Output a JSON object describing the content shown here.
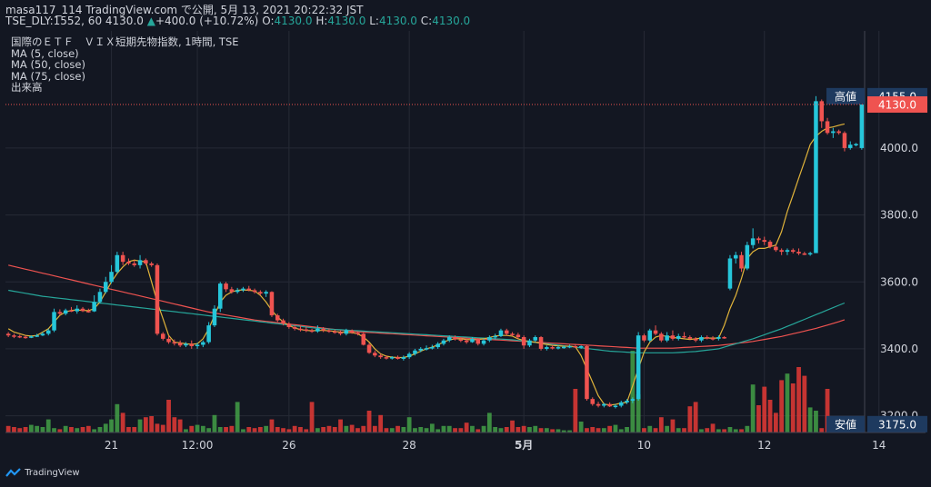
{
  "header": {
    "line1": "masa117_114 TradingView.com で公開, 5月 13, 2021 20:22:32 JST",
    "symbol": "TSE_DLY:1552, 60",
    "price": "4130.0",
    "change_arrow": "▲",
    "change": "+400.0 (+10.72%)",
    "o_label": "O:",
    "o_value": "4130.0",
    "h_label": "H:",
    "h_value": "4130.0",
    "l_label": "L:",
    "l_value": "4130.0",
    "c_label": "C:",
    "c_value": "4130.0"
  },
  "legend": {
    "title": "国際のＥＴＦ　ＶＩＸ短期先物指数, 1時間, TSE",
    "ma5": "MA (5, close)",
    "ma50": "MA (50, close)",
    "ma75": "MA (75, close)",
    "volume": "出来高"
  },
  "watermark": "TradingView",
  "colors": {
    "background": "#131722",
    "up": "#26c6da",
    "down": "#ef5350",
    "vol_up": "#43a047",
    "vol_down": "#e53935",
    "ma5": "#e0b33a",
    "ma50": "#26a69a",
    "ma75": "#ef5350",
    "label_box": "#1e3a5f"
  },
  "chart_data": {
    "type": "candlestick",
    "title": "国際のＥＴＦ　ＶＩＸ短期先物指数, 1時間, TSE",
    "ylim": [
      3150,
      4350
    ],
    "y_ticks": [
      "3200.0",
      "3400.0",
      "3600.0",
      "3800.0",
      "4000.0"
    ],
    "y_tick_values": [
      3200,
      3400,
      3600,
      3800,
      4000
    ],
    "x_labels": [
      "21",
      "12:00",
      "26",
      "28",
      "5月",
      "10",
      "12",
      "14"
    ],
    "x_label_bars": [
      18,
      33,
      49,
      70,
      90,
      111,
      132,
      152
    ],
    "markers": [
      {
        "label": "高値",
        "value": 4155.0,
        "text": "4155.0"
      },
      {
        "label": "",
        "value": 4130.0,
        "text": "4130.0"
      },
      {
        "label": "安値",
        "value": 3175.0,
        "text": "3175.0"
      }
    ],
    "candles": [
      [
        3445,
        3450,
        3435,
        3440
      ],
      [
        3440,
        3445,
        3432,
        3438
      ],
      [
        3438,
        3442,
        3432,
        3436
      ],
      [
        3436,
        3440,
        3430,
        3434
      ],
      [
        3434,
        3440,
        3432,
        3437
      ],
      [
        3437,
        3445,
        3435,
        3440
      ],
      [
        3440,
        3450,
        3438,
        3445
      ],
      [
        3445,
        3460,
        3440,
        3455
      ],
      [
        3455,
        3520,
        3450,
        3510
      ],
      [
        3510,
        3518,
        3500,
        3505
      ],
      [
        3505,
        3520,
        3500,
        3515
      ],
      [
        3515,
        3525,
        3510,
        3512
      ],
      [
        3512,
        3530,
        3505,
        3520
      ],
      [
        3520,
        3525,
        3510,
        3513
      ],
      [
        3513,
        3520,
        3508,
        3512
      ],
      [
        3512,
        3560,
        3510,
        3540
      ],
      [
        3540,
        3580,
        3535,
        3570
      ],
      [
        3570,
        3615,
        3565,
        3600
      ],
      [
        3600,
        3650,
        3595,
        3630
      ],
      [
        3630,
        3690,
        3625,
        3680
      ],
      [
        3680,
        3690,
        3650,
        3660
      ],
      [
        3660,
        3670,
        3650,
        3655
      ],
      [
        3655,
        3665,
        3645,
        3650
      ],
      [
        3650,
        3680,
        3640,
        3665
      ],
      [
        3665,
        3670,
        3650,
        3655
      ],
      [
        3655,
        3660,
        3645,
        3650
      ],
      [
        3650,
        3655,
        3440,
        3445
      ],
      [
        3445,
        3450,
        3425,
        3430
      ],
      [
        3430,
        3440,
        3415,
        3420
      ],
      [
        3420,
        3428,
        3410,
        3418
      ],
      [
        3418,
        3425,
        3405,
        3410
      ],
      [
        3410,
        3420,
        3405,
        3415
      ],
      [
        3415,
        3425,
        3400,
        3408
      ],
      [
        3408,
        3418,
        3400,
        3412
      ],
      [
        3412,
        3425,
        3405,
        3420
      ],
      [
        3420,
        3480,
        3415,
        3470
      ],
      [
        3470,
        3530,
        3465,
        3520
      ],
      [
        3520,
        3600,
        3510,
        3595
      ],
      [
        3595,
        3600,
        3570,
        3578
      ],
      [
        3578,
        3585,
        3565,
        3570
      ],
      [
        3570,
        3582,
        3565,
        3575
      ],
      [
        3575,
        3585,
        3570,
        3580
      ],
      [
        3580,
        3588,
        3572,
        3575
      ],
      [
        3575,
        3580,
        3565,
        3570
      ],
      [
        3570,
        3575,
        3560,
        3565
      ],
      [
        3565,
        3575,
        3555,
        3570
      ],
      [
        3570,
        3572,
        3495,
        3500
      ],
      [
        3500,
        3505,
        3480,
        3485
      ],
      [
        3485,
        3490,
        3470,
        3475
      ],
      [
        3475,
        3480,
        3460,
        3465
      ],
      [
        3465,
        3470,
        3455,
        3460
      ],
      [
        3460,
        3468,
        3452,
        3458
      ],
      [
        3458,
        3465,
        3450,
        3455
      ],
      [
        3455,
        3460,
        3448,
        3452
      ],
      [
        3452,
        3470,
        3448,
        3460
      ],
      [
        3460,
        3465,
        3450,
        3455
      ],
      [
        3455,
        3460,
        3448,
        3452
      ],
      [
        3452,
        3458,
        3445,
        3450
      ],
      [
        3450,
        3455,
        3440,
        3445
      ],
      [
        3445,
        3460,
        3440,
        3455
      ],
      [
        3455,
        3458,
        3445,
        3448
      ],
      [
        3448,
        3452,
        3440,
        3445
      ],
      [
        3445,
        3448,
        3410,
        3412
      ],
      [
        3412,
        3418,
        3385,
        3388
      ],
      [
        3388,
        3395,
        3375,
        3380
      ],
      [
        3380,
        3385,
        3370,
        3375
      ],
      [
        3375,
        3380,
        3368,
        3372
      ],
      [
        3372,
        3378,
        3368,
        3375
      ],
      [
        3375,
        3380,
        3368,
        3370
      ],
      [
        3370,
        3380,
        3365,
        3375
      ],
      [
        3375,
        3390,
        3370,
        3385
      ],
      [
        3385,
        3400,
        3380,
        3395
      ],
      [
        3395,
        3405,
        3390,
        3400
      ],
      [
        3400,
        3410,
        3395,
        3402
      ],
      [
        3402,
        3412,
        3398,
        3405
      ],
      [
        3405,
        3420,
        3400,
        3415
      ],
      [
        3415,
        3430,
        3410,
        3425
      ],
      [
        3425,
        3440,
        3420,
        3435
      ],
      [
        3435,
        3440,
        3425,
        3428
      ],
      [
        3428,
        3435,
        3420,
        3425
      ],
      [
        3425,
        3430,
        3415,
        3420
      ],
      [
        3420,
        3435,
        3418,
        3430
      ],
      [
        3430,
        3432,
        3410,
        3415
      ],
      [
        3415,
        3430,
        3410,
        3425
      ],
      [
        3425,
        3440,
        3420,
        3435
      ],
      [
        3435,
        3445,
        3428,
        3438
      ],
      [
        3438,
        3460,
        3435,
        3455
      ],
      [
        3455,
        3460,
        3440,
        3445
      ],
      [
        3445,
        3450,
        3438,
        3442
      ],
      [
        3442,
        3448,
        3430,
        3435
      ],
      [
        3435,
        3440,
        3400,
        3410
      ],
      [
        3410,
        3430,
        3405,
        3425
      ],
      [
        3425,
        3440,
        3420,
        3435
      ],
      [
        3435,
        3438,
        3395,
        3400
      ],
      [
        3400,
        3410,
        3395,
        3405
      ],
      [
        3405,
        3412,
        3398,
        3402
      ],
      [
        3402,
        3410,
        3398,
        3405
      ],
      [
        3405,
        3410,
        3400,
        3406
      ],
      [
        3406,
        3412,
        3402,
        3408
      ],
      [
        3408,
        3412,
        3403,
        3405
      ],
      [
        3405,
        3410,
        3400,
        3408
      ],
      [
        3408,
        3410,
        3245,
        3250
      ],
      [
        3250,
        3255,
        3230,
        3235
      ],
      [
        3235,
        3242,
        3225,
        3230
      ],
      [
        3230,
        3238,
        3225,
        3235
      ],
      [
        3235,
        3240,
        3226,
        3228
      ],
      [
        3228,
        3235,
        3222,
        3230
      ],
      [
        3230,
        3245,
        3225,
        3240
      ],
      [
        3240,
        3250,
        3235,
        3245
      ],
      [
        3245,
        3255,
        3238,
        3250
      ],
      [
        3250,
        3450,
        3245,
        3440
      ],
      [
        3440,
        3445,
        3420,
        3425
      ],
      [
        3425,
        3460,
        3420,
        3455
      ],
      [
        3455,
        3470,
        3440,
        3445
      ],
      [
        3445,
        3450,
        3420,
        3425
      ],
      [
        3425,
        3450,
        3420,
        3440
      ],
      [
        3440,
        3455,
        3425,
        3430
      ],
      [
        3430,
        3445,
        3425,
        3438
      ],
      [
        3438,
        3450,
        3430,
        3435
      ],
      [
        3435,
        3440,
        3428,
        3430
      ],
      [
        3430,
        3435,
        3420,
        3425
      ],
      [
        3425,
        3440,
        3420,
        3435
      ],
      [
        3435,
        3440,
        3428,
        3432
      ],
      [
        3432,
        3438,
        3425,
        3430
      ],
      [
        3430,
        3440,
        3425,
        3435
      ],
      [
        3435,
        3438,
        3430,
        3432
      ],
      [
        3580,
        3680,
        3575,
        3670
      ],
      [
        3670,
        3690,
        3655,
        3680
      ],
      [
        3680,
        3690,
        3630,
        3640
      ],
      [
        3640,
        3720,
        3635,
        3710
      ],
      [
        3710,
        3760,
        3700,
        3730
      ],
      [
        3730,
        3735,
        3715,
        3725
      ],
      [
        3725,
        3735,
        3710,
        3720
      ],
      [
        3720,
        3725,
        3700,
        3705
      ],
      [
        3705,
        3710,
        3690,
        3695
      ],
      [
        3695,
        3700,
        3680,
        3690
      ],
      [
        3690,
        3700,
        3680,
        3695
      ],
      [
        3695,
        3700,
        3685,
        3690
      ],
      [
        3690,
        3700,
        3680,
        3685
      ],
      [
        3685,
        3690,
        3680,
        3684
      ],
      [
        3684,
        3690,
        3678,
        3686
      ],
      [
        3686,
        4155,
        4050,
        4140
      ],
      [
        4140,
        4145,
        4060,
        4080
      ],
      [
        4080,
        4090,
        4040,
        4045
      ],
      [
        4045,
        4060,
        4030,
        4050
      ],
      [
        4050,
        4055,
        4040,
        4045
      ],
      [
        4045,
        4050,
        3990,
        4000
      ],
      [
        4000,
        4020,
        3995,
        4010
      ],
      [
        4010,
        4015,
        4005,
        4012
      ],
      [
        4000,
        4130,
        3995,
        4130
      ]
    ],
    "volumes": [
      6,
      5,
      4,
      5,
      7,
      6,
      5,
      12,
      4,
      3,
      6,
      5,
      4,
      5,
      6,
      3,
      5,
      8,
      12,
      26,
      18,
      5,
      5,
      12,
      14,
      15,
      8,
      7,
      30,
      14,
      12,
      3,
      6,
      7,
      6,
      4,
      16,
      5,
      5,
      6,
      28,
      3,
      5,
      4,
      5,
      6,
      12,
      5,
      4,
      3,
      6,
      5,
      3,
      28,
      4,
      5,
      6,
      5,
      12,
      6,
      7,
      4,
      6,
      20,
      6,
      16,
      4,
      4,
      6,
      5,
      14,
      4,
      5,
      4,
      8,
      3,
      6,
      6,
      4,
      4,
      9,
      6,
      3,
      6,
      18,
      5,
      4,
      5,
      11,
      5,
      6,
      5,
      6,
      4,
      4,
      3,
      3,
      2,
      2,
      40,
      10,
      4,
      5,
      4,
      4,
      6,
      7,
      3,
      5,
      75,
      35,
      4,
      6,
      4,
      14,
      6,
      12,
      4,
      4,
      24,
      28,
      3,
      4,
      8,
      3,
      3,
      5,
      3,
      3,
      6,
      44,
      25,
      42,
      30,
      18,
      48,
      54,
      45,
      60,
      52,
      23,
      20,
      4,
      40
    ],
    "ma5": [
      3460,
      3450,
      3445,
      3440,
      3438,
      3440,
      3450,
      3460,
      3480,
      3500,
      3510,
      3515,
      3516,
      3515,
      3514,
      3520,
      3540,
      3570,
      3600,
      3625,
      3645,
      3660,
      3665,
      3662,
      3660,
      3600,
      3540,
      3490,
      3440,
      3420,
      3418,
      3415,
      3414,
      3415,
      3430,
      3460,
      3500,
      3540,
      3560,
      3570,
      3575,
      3576,
      3575,
      3573,
      3560,
      3540,
      3515,
      3495,
      3480,
      3470,
      3462,
      3458,
      3455,
      3454,
      3455,
      3455,
      3454,
      3452,
      3450,
      3449,
      3448,
      3445,
      3435,
      3420,
      3400,
      3385,
      3378,
      3375,
      3374,
      3374,
      3378,
      3385,
      3393,
      3400,
      3405,
      3412,
      3420,
      3427,
      3430,
      3430,
      3428,
      3427,
      3428,
      3430,
      3434,
      3438,
      3440,
      3440,
      3438,
      3430,
      3425,
      3422,
      3420,
      3416,
      3413,
      3410,
      3409,
      3408,
      3408,
      3406,
      3380,
      3340,
      3300,
      3260,
      3235,
      3232,
      3234,
      3238,
      3240,
      3290,
      3340,
      3390,
      3420,
      3435,
      3440,
      3437,
      3434,
      3432,
      3430,
      3428,
      3430,
      3432,
      3432,
      3432,
      3432,
      3470,
      3520,
      3560,
      3610,
      3670,
      3690,
      3700,
      3700,
      3705,
      3710,
      3750,
      3810,
      3860,
      3910,
      3960,
      4010,
      4035,
      4050,
      4060,
      4063,
      4068,
      4072
    ],
    "ma50": [
      3575,
      3572,
      3569,
      3566,
      3563,
      3560,
      3557,
      3555,
      3553,
      3551,
      3549,
      3547,
      3545,
      3543,
      3541,
      3539,
      3537,
      3535,
      3533,
      3531,
      3529,
      3527,
      3525,
      3523,
      3521,
      3519,
      3517,
      3515,
      3513,
      3511,
      3509,
      3507,
      3505,
      3503,
      3501,
      3499,
      3497,
      3495,
      3493,
      3491,
      3489,
      3487,
      3485,
      3483,
      3481,
      3479,
      3477,
      3475,
      3473,
      3471,
      3469,
      3467,
      3465,
      3463,
      3461,
      3460,
      3459,
      3458,
      3457,
      3456,
      3455,
      3454,
      3453,
      3452,
      3451,
      3450,
      3449,
      3448,
      3447,
      3446,
      3445,
      3444,
      3443,
      3442,
      3441,
      3440,
      3439,
      3438,
      3437,
      3436,
      3435,
      3434,
      3433,
      3432,
      3431,
      3430,
      3429,
      3428,
      3427,
      3425,
      3423,
      3421,
      3419,
      3417,
      3415,
      3413,
      3411,
      3409,
      3407,
      3405,
      3403,
      3401,
      3399,
      3397,
      3395,
      3393,
      3392,
      3391,
      3390,
      3389,
      3388,
      3388,
      3388,
      3388,
      3388,
      3388,
      3388,
      3389,
      3390,
      3391,
      3392,
      3394,
      3396,
      3398,
      3400,
      3405,
      3410,
      3415,
      3420,
      3425,
      3430,
      3436,
      3442,
      3448,
      3454,
      3460,
      3467,
      3474,
      3481,
      3488,
      3495,
      3502,
      3509,
      3516,
      3523,
      3530,
      3537
    ],
    "ma75": [
      3650,
      3646,
      3642,
      3638,
      3634,
      3630,
      3626,
      3622,
      3618,
      3614,
      3610,
      3606,
      3602,
      3598,
      3594,
      3590,
      3586,
      3582,
      3578,
      3574,
      3570,
      3566,
      3562,
      3558,
      3554,
      3550,
      3546,
      3542,
      3538,
      3534,
      3530,
      3526,
      3522,
      3518,
      3514,
      3510,
      3507,
      3504,
      3501,
      3498,
      3495,
      3492,
      3489,
      3486,
      3484,
      3482,
      3480,
      3478,
      3476,
      3474,
      3472,
      3470,
      3468,
      3466,
      3464,
      3462,
      3460,
      3458,
      3456,
      3454,
      3452,
      3451,
      3450,
      3449,
      3448,
      3447,
      3446,
      3445,
      3444,
      3443,
      3442,
      3441,
      3440,
      3439,
      3438,
      3437,
      3436,
      3435,
      3434,
      3433,
      3432,
      3431,
      3430,
      3429,
      3428,
      3427,
      3426,
      3425,
      3424,
      3423,
      3422,
      3421,
      3420,
      3419,
      3418,
      3417,
      3416,
      3415,
      3414,
      3413,
      3412,
      3411,
      3410,
      3409,
      3408,
      3407,
      3406,
      3405,
      3404,
      3403,
      3402,
      3402,
      3402,
      3402,
      3402,
      3402,
      3402,
      3403,
      3404,
      3405,
      3406,
      3407,
      3408,
      3409,
      3410,
      3412,
      3414,
      3416,
      3418,
      3420,
      3422,
      3425,
      3428,
      3431,
      3434,
      3437,
      3441,
      3445,
      3449,
      3453,
      3457,
      3461,
      3466,
      3471,
      3476,
      3481,
      3487
    ]
  }
}
